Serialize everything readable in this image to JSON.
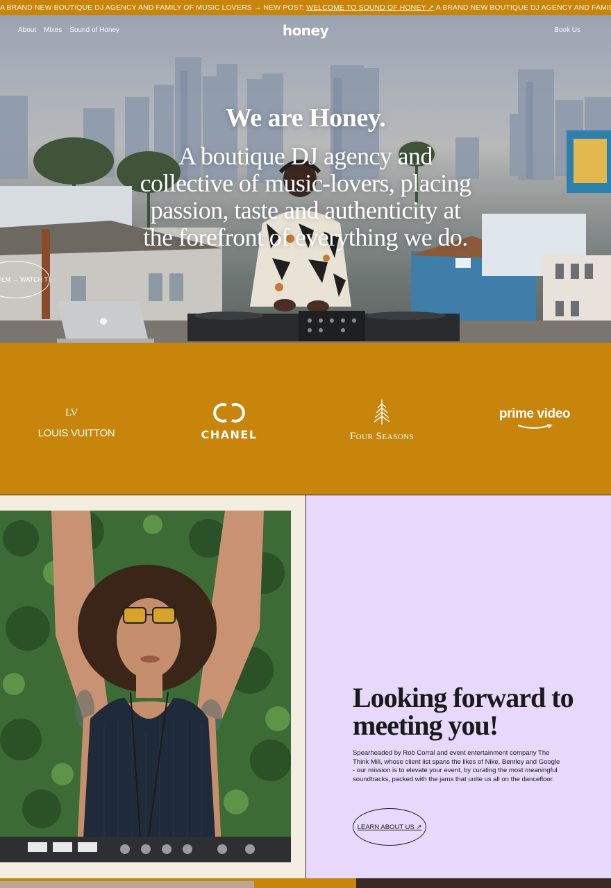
{
  "marquee": {
    "lead": "A BRAND NEW BOUTIQUE DJ AGENCY AND FAMILY OF MUSIC LOVERS → NEW POST: ",
    "link": "WELCOME TO SOUND OF HONEY ↗",
    "tail": " A BRAND NEW BOUTIQUE DJ AGENCY AND FAMILY OF MUSIC LOVERS"
  },
  "nav": {
    "items": [
      {
        "label": "About"
      },
      {
        "label": "Mixes"
      },
      {
        "label": "Sound of Honey"
      }
    ],
    "logo": "honey",
    "cta": "Book Us"
  },
  "hero": {
    "title": "We are Honey.",
    "subtitle": "A boutique DJ agency and collective of music-lovers, placing passion, taste and authenticity at the forefront of everything we do.",
    "film_link": "FILM → WATCH T"
  },
  "clients": [
    {
      "mark": "LV",
      "name": "LOUIS VUITTON"
    },
    {
      "name": "CHANEL"
    },
    {
      "name": "Four Seasons"
    },
    {
      "name": "prime video"
    }
  ],
  "about": {
    "heading": "Looking forward to meeting you!",
    "body": "Spearheaded by Rob Corral and event entertainment company The Think Mill, whose client list spans the likes of Nike, Bentley and Google - our mission is to elevate your event, by curating the most meaningful soundtracks, packed with the jams that unite us all on the dancefloor.",
    "button": "LEARN ABOUT US ↗"
  },
  "colors": {
    "accent": "#c7850c",
    "lavender": "#e6d9fb",
    "cream": "#f4ede2"
  }
}
